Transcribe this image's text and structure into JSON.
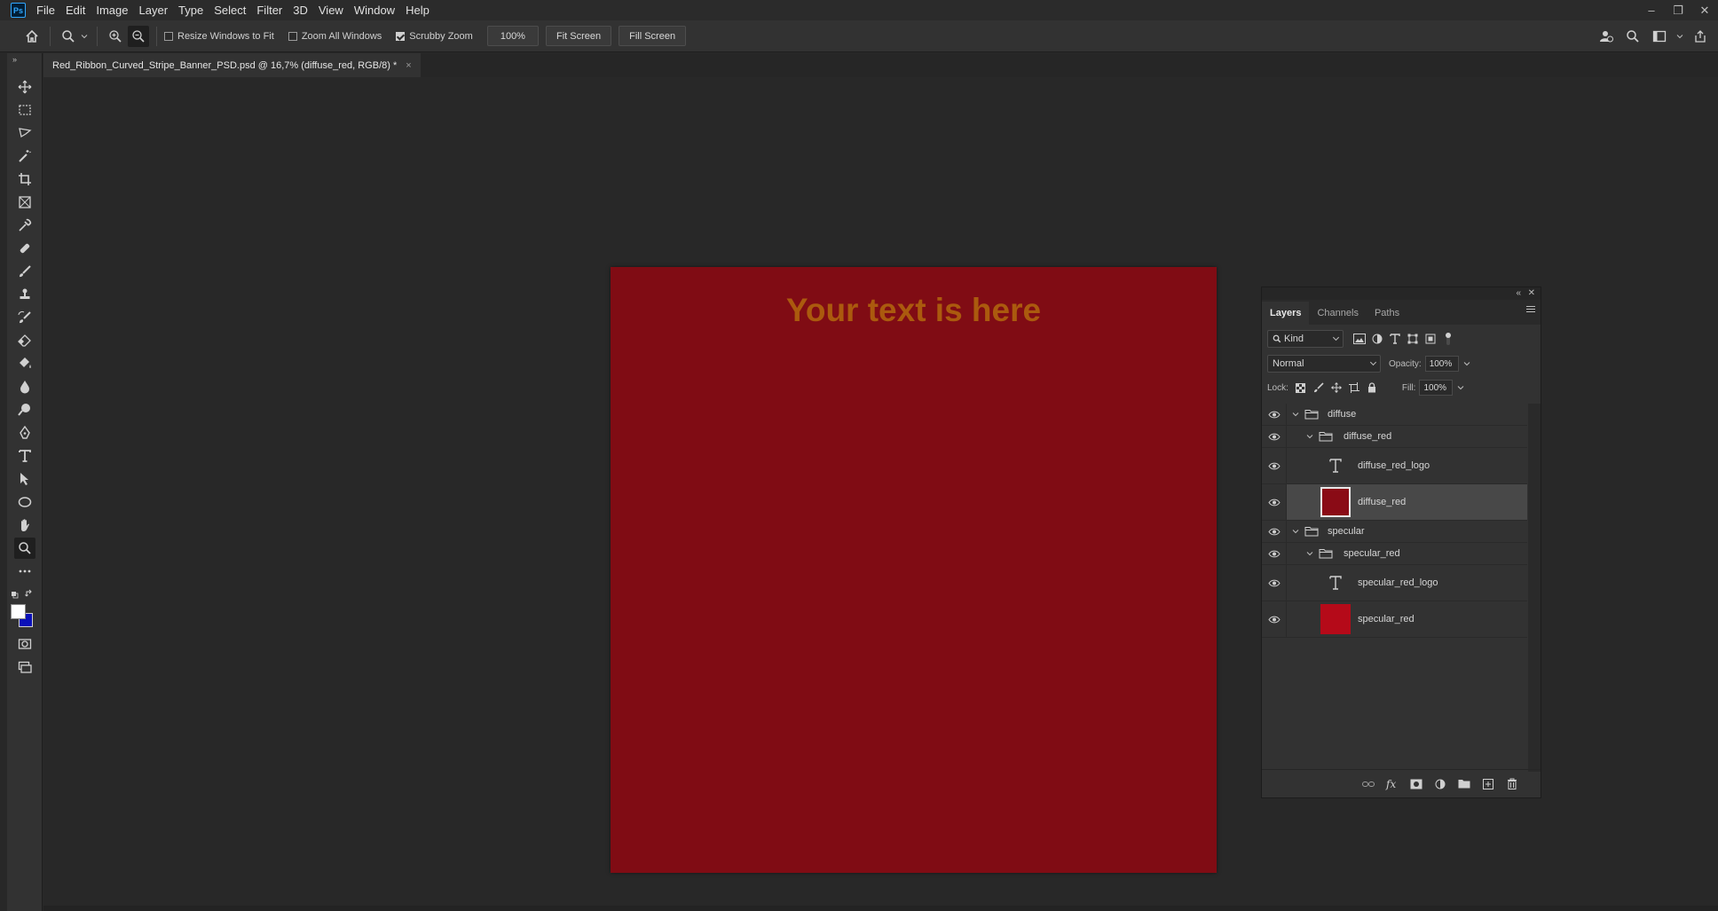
{
  "app": {
    "logo_text": "Ps"
  },
  "menu": [
    "File",
    "Edit",
    "Image",
    "Layer",
    "Type",
    "Select",
    "Filter",
    "3D",
    "View",
    "Window",
    "Help"
  ],
  "window_controls": {
    "minimize": "–",
    "restore": "❐",
    "close": "✕"
  },
  "options_bar": {
    "resize_windows_label": "Resize Windows to Fit",
    "zoom_all_label": "Zoom All Windows",
    "scrubby_label": "Scrubby Zoom",
    "zoom_value": "100%",
    "fit_screen": "Fit Screen",
    "fill_screen": "Fill Screen",
    "resize_windows_checked": false,
    "zoom_all_checked": false,
    "scrubby_checked": true
  },
  "document": {
    "tab_title": "Red_Ribbon_Curved_Stripe_Banner_PSD.psd @ 16,7% (diffuse_red, RGB/8) *",
    "tab_close": "×",
    "canvas_text": "Your text is here",
    "canvas_color": "#800c14",
    "text_color": "#ab5a0e"
  },
  "layers_panel": {
    "tabs": [
      "Layers",
      "Channels",
      "Paths"
    ],
    "active_tab": "Layers",
    "filter_kind": "Kind",
    "blend_mode": "Normal",
    "opacity_label": "Opacity:",
    "opacity_value": "100%",
    "lock_label": "Lock:",
    "fill_label": "Fill:",
    "fill_value": "100%",
    "layers": [
      {
        "name": "diffuse",
        "kind": "group"
      },
      {
        "name": "diffuse_red",
        "kind": "group"
      },
      {
        "name": "diffuse_red_logo",
        "kind": "text"
      },
      {
        "name": "diffuse_red",
        "kind": "fill",
        "color": "#8a0b16",
        "selected": true
      },
      {
        "name": "specular",
        "kind": "group"
      },
      {
        "name": "specular_red",
        "kind": "group"
      },
      {
        "name": "specular_red_logo",
        "kind": "text"
      },
      {
        "name": "specular_red",
        "kind": "fill",
        "color": "#b50a19"
      }
    ]
  }
}
